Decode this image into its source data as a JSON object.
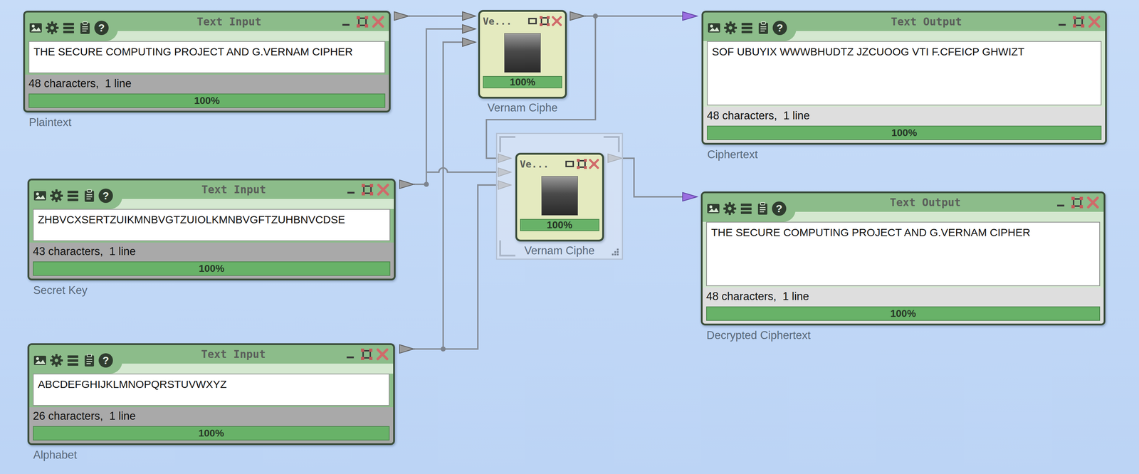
{
  "help_glyph": "?",
  "text_inputs": [
    {
      "title": "Text Input",
      "content": "THE SECURE COMPUTING PROJECT AND G.VERNAM CIPHER",
      "info": "48 characters,  1 line",
      "progress": "100%",
      "level": 1,
      "label": "Plaintext"
    },
    {
      "title": "Text Input",
      "content": "ZHBVCXSERTZUIKMNBVGTZUIOLKMNBVGFTZUHBNVCDSE",
      "info": "43 characters,  1 line",
      "progress": "100%",
      "level": 1,
      "label": "Secret Key"
    },
    {
      "title": "Text Input",
      "content": "ABCDEFGHIJKLMNOPQRSTUVWXYZ",
      "info": "26 characters,  1 line",
      "progress": "100%",
      "level": 1,
      "label": "Alphabet"
    }
  ],
  "components": [
    {
      "title": "Ve...",
      "progress": "100%",
      "level": 1,
      "label": "Vernam Ciphe",
      "selected": false
    },
    {
      "title": "Ve...",
      "progress": "100%",
      "level": 1,
      "label": "Vernam Ciphe",
      "selected": true
    }
  ],
  "text_outputs": [
    {
      "title": "Text Output",
      "content": "SOF UBUYIX WWWBHUDTZ JZCUOOG VTI F.CFEICP GHWIZT",
      "info": "48 characters,  1 line",
      "progress": "100%",
      "level": 1,
      "label": "Ciphertext"
    },
    {
      "title": "Text Output",
      "content": "THE SECURE COMPUTING PROJECT AND G.VERNAM CIPHER",
      "info": "48 characters,  1 line",
      "progress": "100%",
      "level": 1,
      "label": "Decrypted Ciphertext"
    }
  ]
}
